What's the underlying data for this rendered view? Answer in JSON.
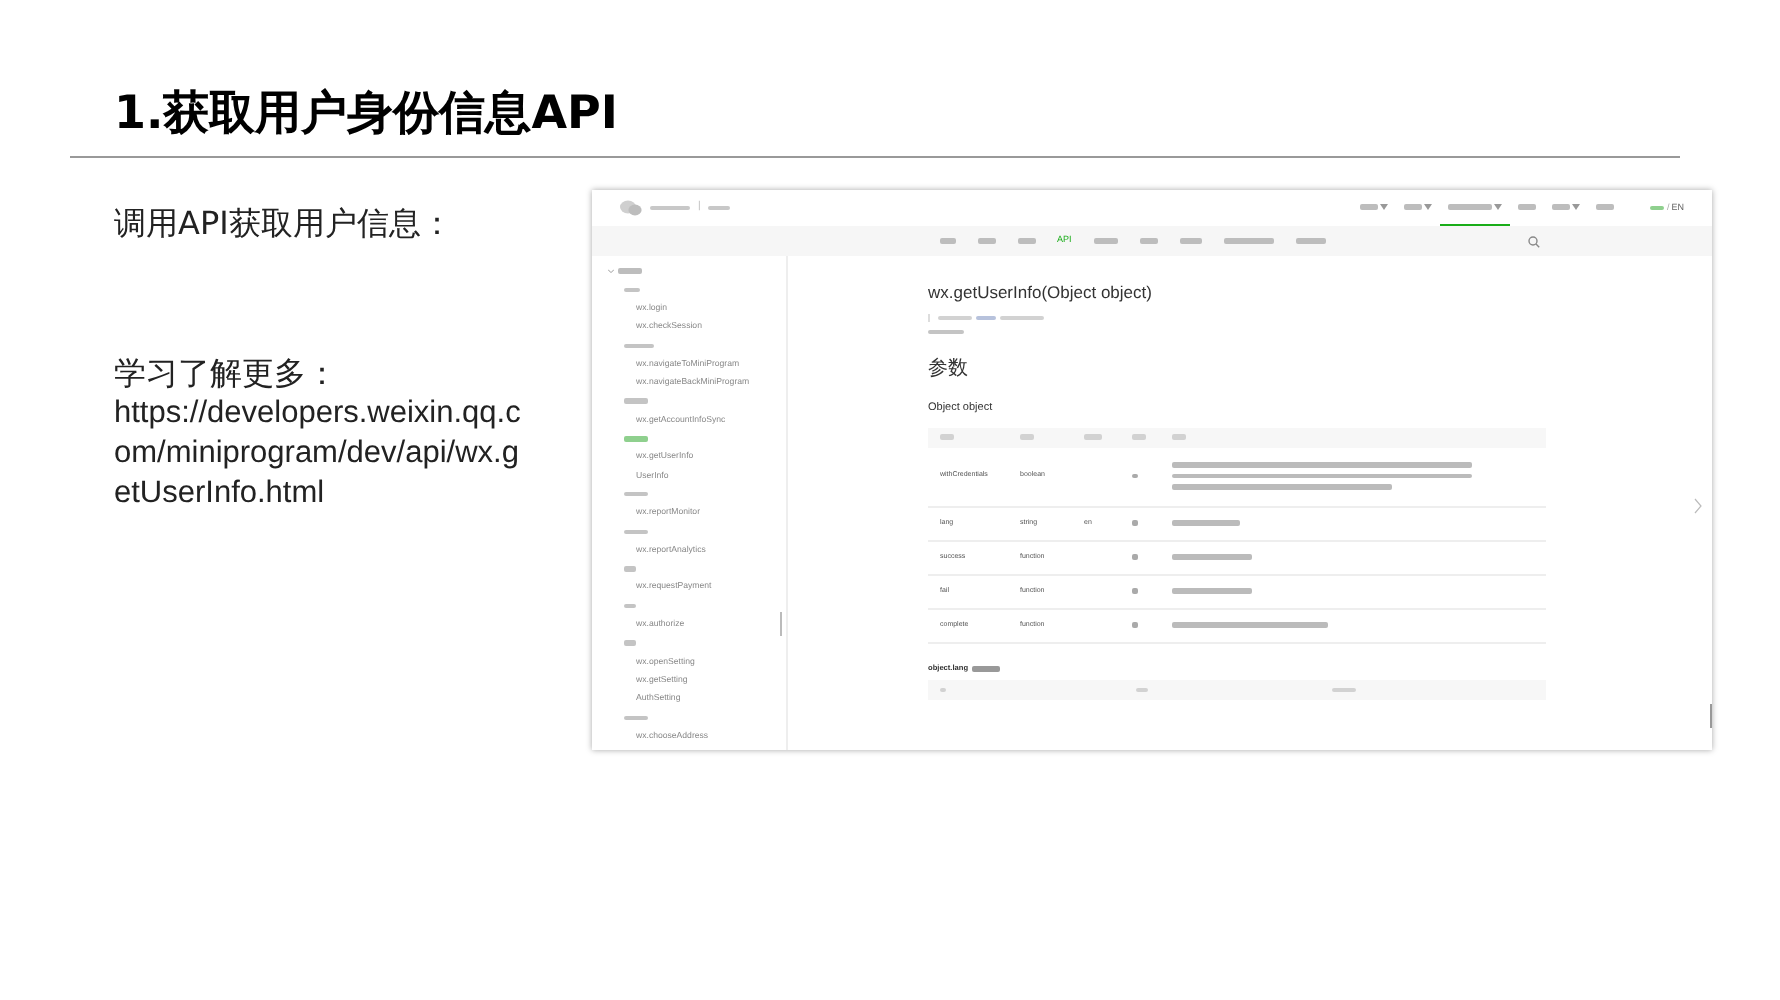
{
  "slide": {
    "title": "1.获取用户身份信息API",
    "intro": "调用API获取用户信息：",
    "more_label": "学习了解更多：",
    "more_url": "https://developers.weixin.qq.com/miniprogram/dev/api/wx.getUserInfo.html"
  },
  "screenshot": {
    "header": {
      "separator": "|",
      "nav": [
        {
          "has_menu": true,
          "selected": false
        },
        {
          "has_menu": true,
          "selected": false
        },
        {
          "has_menu": true,
          "selected": true
        },
        {
          "has_menu": false,
          "selected": false
        },
        {
          "has_menu": true,
          "selected": false
        },
        {
          "has_menu": false,
          "selected": false
        }
      ],
      "lang": [
        {
          "selected": true
        },
        {
          "label": "EN",
          "selected": false
        }
      ],
      "lang_separator": "/"
    },
    "tabs": [
      {
        "selected": false
      },
      {
        "selected": false
      },
      {
        "selected": false
      },
      {
        "label": "API",
        "selected": true
      },
      {
        "selected": false
      },
      {
        "selected": false
      },
      {
        "selected": false
      },
      {
        "selected": false
      },
      {
        "selected": false
      }
    ],
    "sidebar": {
      "expanded": true,
      "children": [
        {
          "selected": false,
          "children": [
            {
              "label": "wx.login",
              "selected": false
            },
            {
              "label": "wx.checkSession",
              "selected": false
            }
          ]
        },
        {
          "selected": false,
          "children": [
            {
              "label": "wx.navigateToMiniProgram",
              "selected": false
            },
            {
              "label": "wx.navigateBackMiniProgram",
              "selected": false
            }
          ]
        },
        {
          "selected": false,
          "children": [
            {
              "label": "wx.getAccountInfoSync",
              "selected": false
            }
          ]
        },
        {
          "selected": true,
          "children": [
            {
              "label": "wx.getUserInfo",
              "selected": false
            },
            {
              "label": "UserInfo",
              "selected": false
            }
          ]
        },
        {
          "selected": false,
          "children": [
            {
              "label": "wx.reportMonitor",
              "selected": false
            }
          ]
        },
        {
          "selected": false,
          "children": [
            {
              "label": "wx.reportAnalytics",
              "selected": false
            }
          ]
        },
        {
          "selected": false,
          "children": [
            {
              "label": "wx.requestPayment",
              "selected": false
            }
          ]
        },
        {
          "selected": false,
          "children": [
            {
              "label": "wx.authorize",
              "selected": false
            }
          ]
        },
        {
          "selected": false,
          "children": [
            {
              "label": "wx.openSetting",
              "selected": false
            },
            {
              "label": "wx.getSetting",
              "selected": false
            },
            {
              "label": "AuthSetting",
              "selected": false
            }
          ]
        },
        {
          "selected": false,
          "children": [
            {
              "label": "wx.chooseAddress",
              "selected": false
            }
          ]
        }
      ]
    },
    "doc": {
      "title": "wx.getUserInfo(Object object)",
      "params_heading": "参数",
      "object_heading": "Object object",
      "rows": [
        {
          "name": "withCredentials",
          "type": "boolean"
        },
        {
          "name": "lang",
          "type": "string",
          "default": "en"
        },
        {
          "name": "success",
          "type": "function"
        },
        {
          "name": "fail",
          "type": "function"
        },
        {
          "name": "complete",
          "type": "function"
        }
      ],
      "lang_heading": "object.lang"
    }
  }
}
